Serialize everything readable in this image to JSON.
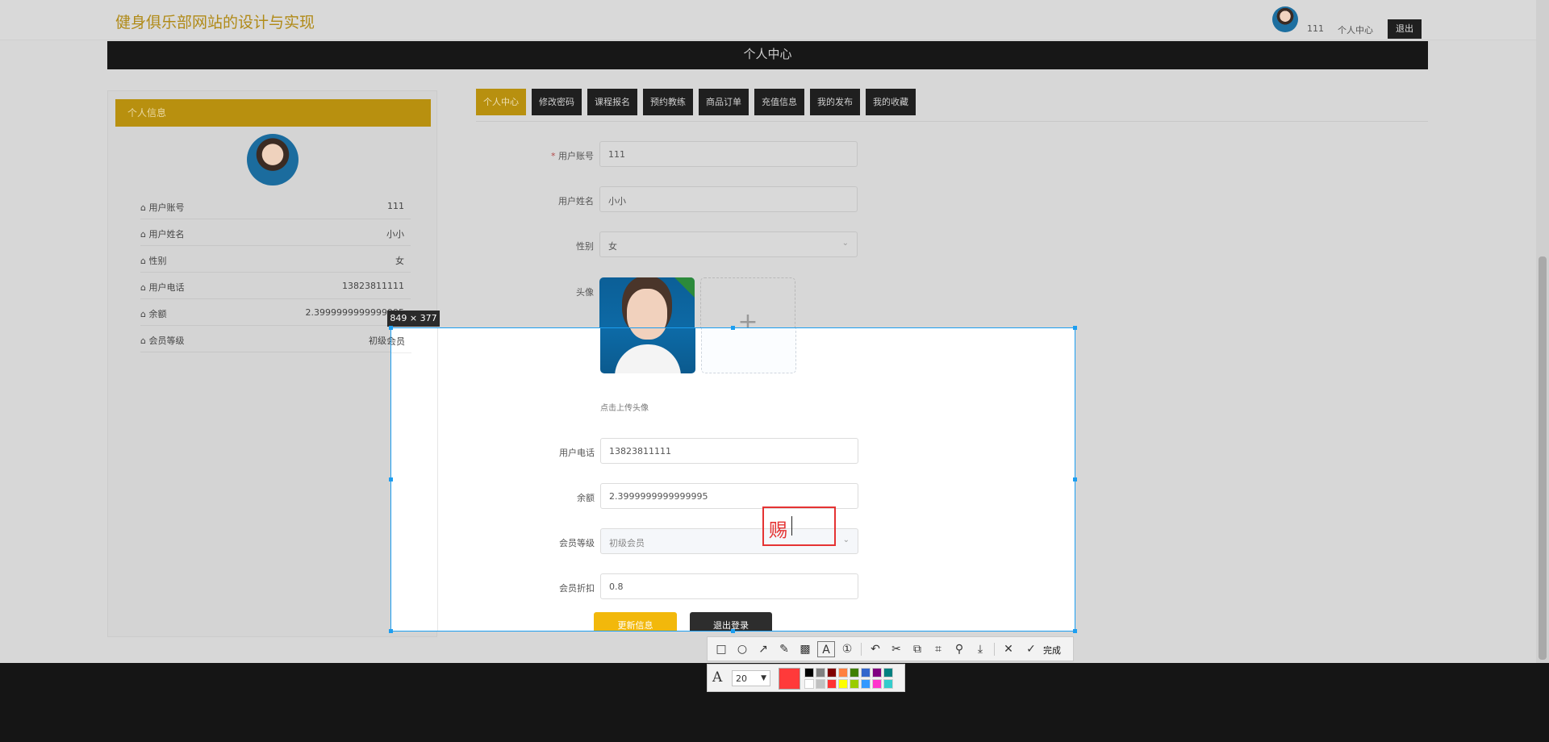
{
  "site_title": "健身俱乐部网站的设计与实现",
  "topbar": {
    "username": "111",
    "center_link": "个人中心",
    "logout": "退出"
  },
  "header_title": "个人中心",
  "left_panel": {
    "heading": "个人信息",
    "rows": [
      {
        "label": "用户账号",
        "value": "111"
      },
      {
        "label": "用户姓名",
        "value": "小小"
      },
      {
        "label": "性别",
        "value": "女"
      },
      {
        "label": "用户电话",
        "value": "13823811111"
      },
      {
        "label": "余额",
        "value": "2.3999999999999995"
      },
      {
        "label": "会员等级",
        "value": "初级会员"
      }
    ]
  },
  "tabs": [
    "个人中心",
    "修改密码",
    "课程报名",
    "预约教练",
    "商品订单",
    "充值信息",
    "我的发布",
    "我的收藏"
  ],
  "form": {
    "account_label": "用户账号",
    "account_value": "111",
    "name_label": "用户姓名",
    "name_value": "小小",
    "gender_label": "性别",
    "gender_value": "女",
    "avatar_label": "头像",
    "upload_tip": "点击上传头像",
    "phone_label": "用户电话",
    "phone_value": "13823811111",
    "balance_label": "余额",
    "balance_value": "2.3999999999999995",
    "level_label": "会员等级",
    "level_value": "初级会员",
    "discount_label": "会员折扣",
    "discount_value": "0.8",
    "update_button": "更新信息",
    "logout_button": "退出登录"
  },
  "screenshot_tool": {
    "size_label": "849 × 377",
    "typed_text": "赐",
    "done_label": "完成",
    "font_size": "20",
    "current_color": "#ff3a3a",
    "palette": [
      "#000000",
      "#808080",
      "#800000",
      "#ff8040",
      "#408000",
      "#3366cc",
      "#800080",
      "#008080",
      "#ffffff",
      "#c0c0c0",
      "#ff3333",
      "#ffff00",
      "#99cc00",
      "#3399ff",
      "#ff33cc",
      "#33cccc"
    ],
    "icons": [
      "rectangle-icon",
      "ellipse-icon",
      "arrow-icon",
      "pen-icon",
      "mosaic-icon",
      "text-icon",
      "number-icon",
      "undo-icon",
      "cut-icon",
      "copy-icon",
      "ocr-icon",
      "pin-icon",
      "download-icon",
      "close-icon",
      "check-icon"
    ]
  }
}
